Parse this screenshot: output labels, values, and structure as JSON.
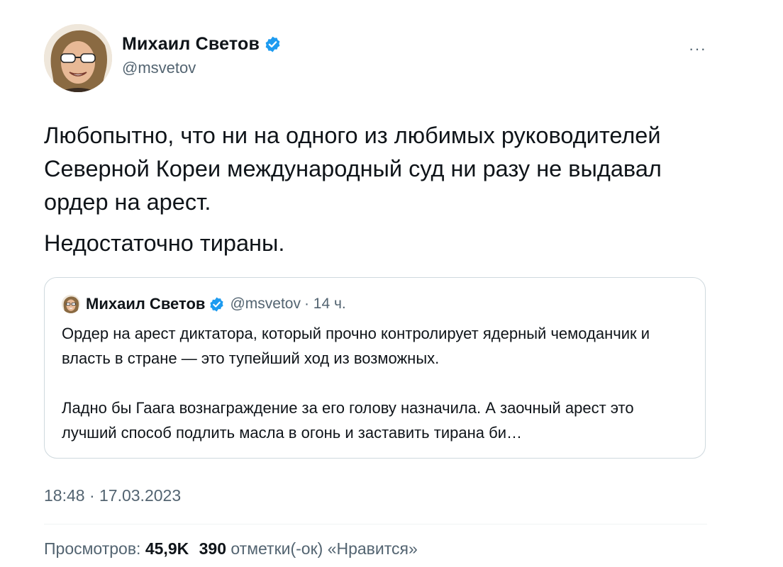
{
  "author": {
    "display_name": "Михаил Светов",
    "handle": "@msvetov",
    "verified": true
  },
  "tweet": {
    "paragraphs": [
      "Любопытно, что ни на одного из любимых руководителей Северной Кореи международный суд ни разу не выдавал ордер на арест.",
      "Недостаточно тираны."
    ],
    "timestamp": "18:48 · 17.03.2023"
  },
  "quoted_tweet": {
    "display_name": "Михаил Светов",
    "handle": "@msvetov",
    "age": "· 14 ч.",
    "paragraphs": [
      "Ордер на арест диктатора, который прочно контролирует ядерный чемоданчик и власть в стране — это тупейший ход из возможных.",
      "Ладно бы Гаага вознаграждение за его голову назначила. А заочный арест это лучший способ подлить масла в огонь и заставить тирана би…"
    ]
  },
  "stats": {
    "views_label": "Просмотров:",
    "views_value": "45,9K",
    "likes_value": "390",
    "likes_label": "отметки(-ок) «Нравится»"
  },
  "menu": {
    "more_label": "···"
  },
  "colors": {
    "verified": "#1d9bf0",
    "secondary_text": "#536471",
    "border": "#cfd9de"
  }
}
